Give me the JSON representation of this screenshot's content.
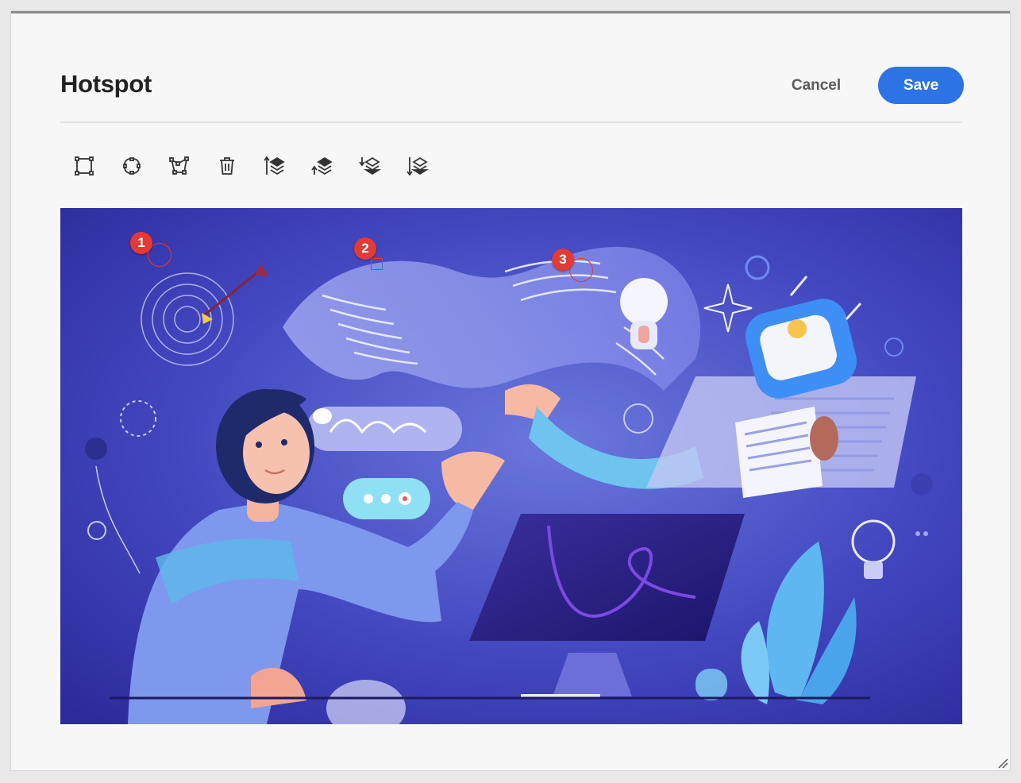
{
  "dialog": {
    "title": "Hotspot",
    "cancel_label": "Cancel",
    "save_label": "Save"
  },
  "toolbar": {
    "tools": [
      {
        "name": "rectangle-hotspot-tool",
        "icon": "rectangle-select-icon"
      },
      {
        "name": "circle-hotspot-tool",
        "icon": "circle-select-icon"
      },
      {
        "name": "polygon-hotspot-tool",
        "icon": "polygon-select-icon"
      },
      {
        "name": "delete-hotspot-tool",
        "icon": "trash-icon"
      },
      {
        "name": "bring-to-front-tool",
        "icon": "bring-to-front-icon"
      },
      {
        "name": "bring-forward-tool",
        "icon": "bring-forward-icon"
      },
      {
        "name": "send-backward-tool",
        "icon": "send-backward-icon"
      },
      {
        "name": "send-to-back-tool",
        "icon": "send-to-back-icon"
      }
    ]
  },
  "hotspots": [
    {
      "number": "1",
      "shape": "circle"
    },
    {
      "number": "2",
      "shape": "rectangle"
    },
    {
      "number": "3",
      "shape": "circle"
    }
  ],
  "colors": {
    "accent": "#2c73e6",
    "hotspot": "#e53935",
    "image_bg": "#3d3fb5"
  }
}
